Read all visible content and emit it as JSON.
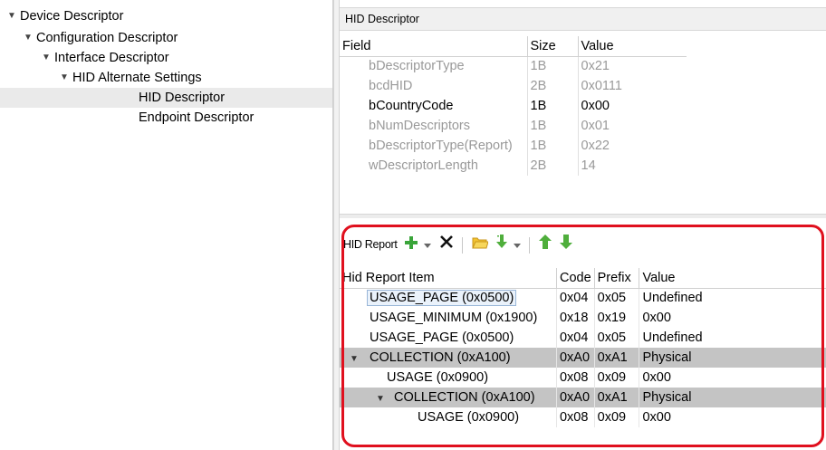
{
  "tree": {
    "nodes": [
      {
        "label": "Device Descriptor",
        "expanded": true
      },
      {
        "label": "Configuration Descriptor",
        "expanded": true
      },
      {
        "label": "Interface Descriptor",
        "expanded": true
      },
      {
        "label": "HID Alternate Settings",
        "expanded": true
      },
      {
        "label": "HID Descriptor",
        "selected": true
      },
      {
        "label": "Endpoint Descriptor"
      }
    ]
  },
  "hid_descriptor": {
    "header": "HID Descriptor",
    "columns": [
      "Field",
      "Size",
      "Value"
    ],
    "rows": [
      {
        "field": "bDescriptorType",
        "size": "1B",
        "value": "0x21"
      },
      {
        "field": "bcdHID",
        "size": "2B",
        "value": "0x0111"
      },
      {
        "field": "bCountryCode",
        "size": "1B",
        "value": "0x00"
      },
      {
        "field": "bNumDescriptors",
        "size": "1B",
        "value": "0x01"
      },
      {
        "field": "bDescriptorType(Report)",
        "size": "1B",
        "value": "0x22"
      },
      {
        "field": "wDescriptorLength",
        "size": "2B",
        "value": "14"
      }
    ]
  },
  "hid_report": {
    "title": "HID Report",
    "toolbar_icons": [
      "add-icon",
      "dropdown-icon",
      "delete-icon",
      "open-folder-icon",
      "import-icon",
      "dropdown-icon",
      "move-up-icon",
      "move-down-icon"
    ],
    "columns": [
      "Hid Report Item",
      "Code",
      "Prefix",
      "Value"
    ],
    "rows": [
      {
        "item": "USAGE_PAGE (0x0500)",
        "code": "0x04",
        "prefix": "0x05",
        "value": "Undefined"
      },
      {
        "item": "USAGE_MINIMUM (0x1900)",
        "code": "0x18",
        "prefix": "0x19",
        "value": "0x00"
      },
      {
        "item": "USAGE_PAGE (0x0500)",
        "code": "0x04",
        "prefix": "0x05",
        "value": "Undefined"
      },
      {
        "item": "COLLECTION (0xA100)",
        "code": "0xA0",
        "prefix": "0xA1",
        "value": "Physical"
      },
      {
        "item": "USAGE (0x0900)",
        "code": "0x08",
        "prefix": "0x09",
        "value": "0x00"
      },
      {
        "item": "COLLECTION (0xA100)",
        "code": "0xA0",
        "prefix": "0xA1",
        "value": "Physical"
      },
      {
        "item": "USAGE (0x0900)",
        "code": "0x08",
        "prefix": "0x09",
        "value": "0x00"
      }
    ]
  },
  "colors": {
    "highlight_frame": "#e0101e",
    "group_row": "#c4c4c4",
    "add_icon": "#3aa53a"
  }
}
